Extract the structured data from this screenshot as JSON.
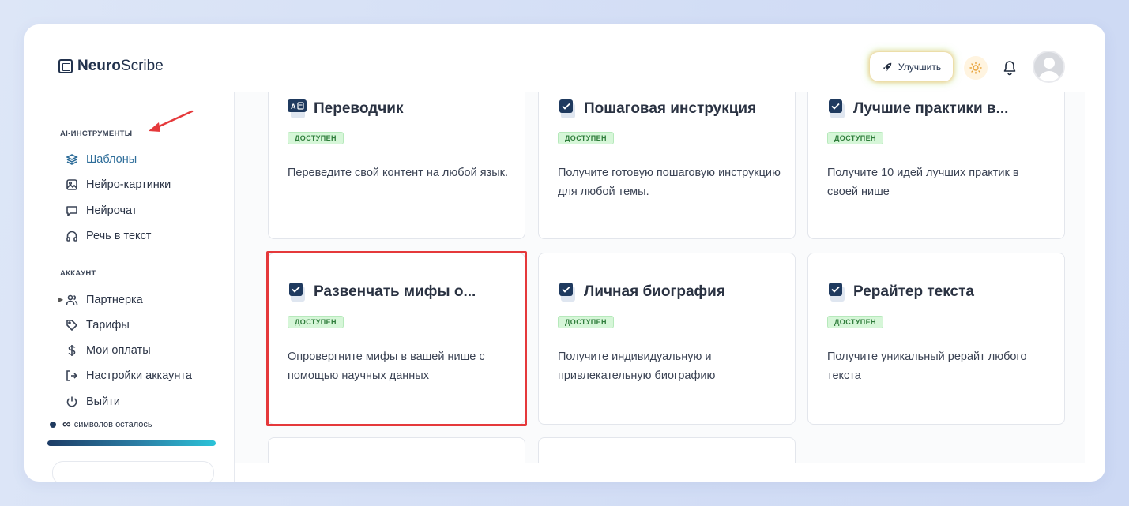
{
  "header": {
    "logo_bold": "Neuro",
    "logo_rest": "Scribe",
    "upgrade_label": "Улучшить"
  },
  "sidebar": {
    "ai_section_title": "AI-ИНСТРУМЕНТЫ",
    "ai_items": [
      {
        "label": "Шаблоны",
        "icon": "layers-icon",
        "active": true
      },
      {
        "label": "Нейро-картинки",
        "icon": "image-icon"
      },
      {
        "label": "Нейрочат",
        "icon": "chat-icon"
      },
      {
        "label": "Речь в текст",
        "icon": "headphones-icon"
      }
    ],
    "account_section_title": "АККАУНТ",
    "account_items": [
      {
        "label": "Партнерка",
        "icon": "users-icon"
      },
      {
        "label": "Тарифы",
        "icon": "tag-icon"
      },
      {
        "label": "Мои оплаты",
        "icon": "dollar-icon"
      },
      {
        "label": "Настройки аккаунта",
        "icon": "logout-arrow-icon"
      },
      {
        "label": "Выйти",
        "icon": "power-icon"
      }
    ],
    "chars_symbol": "∞",
    "chars_label": "символов осталось"
  },
  "cards": [
    {
      "title": "Переводчик",
      "badge": "ДОСТУПЕН",
      "description": "Переведите свой контент на любой язык.",
      "icon": "translate-icon"
    },
    {
      "title": "Пошаговая инструкция",
      "badge": "ДОСТУПЕН",
      "description": "Получите готовую пошаговую инструкцию для любой темы.",
      "icon": "checkbox-icon"
    },
    {
      "title": "Лучшие практики в...",
      "badge": "ДОСТУПЕН",
      "description": "Получите 10 идей лучших практик в своей нише",
      "icon": "checkbox-icon"
    },
    {
      "title": "Развенчать мифы о...",
      "badge": "ДОСТУПЕН",
      "description": "Опровергните мифы в вашей нише с помощью научных данных",
      "icon": "checkbox-icon"
    },
    {
      "title": "Личная биография",
      "badge": "ДОСТУПЕН",
      "description": "Получите индивидуальную и привлекательную биографию",
      "icon": "checkbox-icon"
    },
    {
      "title": "Рерайтер текста",
      "badge": "ДОСТУПЕН",
      "description": "Получите уникальный рерайт любого текста",
      "icon": "checkbox-icon"
    }
  ],
  "colors": {
    "accent": "#2f6e9a",
    "badge_bg": "#d6f6d8",
    "badge_text": "#2f7d3b",
    "highlight": "#e5393b",
    "icon_dark": "#1f3a5f"
  }
}
